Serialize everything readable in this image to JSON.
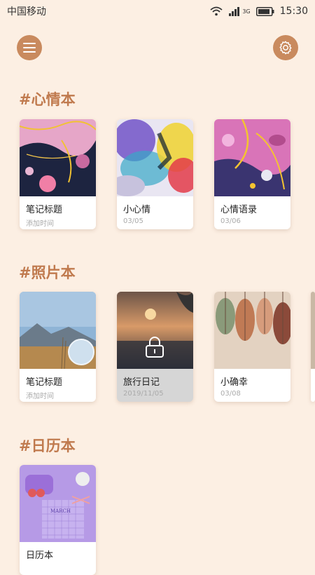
{
  "status": {
    "carrier": "中国移动",
    "network": "3G",
    "time": "15:30",
    "icons": [
      "wifi-icon",
      "signal-icon",
      "battery-icon"
    ]
  },
  "header": {
    "menu_icon": "menu-icon",
    "settings_icon": "gear-icon"
  },
  "sections": [
    {
      "title": "#心情本",
      "cards": [
        {
          "title": "笔记标题",
          "date": "添加时间",
          "locked": false
        },
        {
          "title": "小心情",
          "date": "03/05",
          "locked": false
        },
        {
          "title": "心情语录",
          "date": "03/06",
          "locked": false
        }
      ]
    },
    {
      "title": "#照片本",
      "cards": [
        {
          "title": "笔记标题",
          "date": "添加时间",
          "locked": false
        },
        {
          "title": "旅行日记",
          "date": "2019/11/05",
          "locked": true
        },
        {
          "title": "小确幸",
          "date": "03/08",
          "locked": false
        }
      ]
    },
    {
      "title": "#日历本",
      "cards": [
        {
          "title": "日历本",
          "date": "",
          "locked": false,
          "calendar_month": "MARCH"
        }
      ]
    }
  ],
  "colors": {
    "background": "#fcefe3",
    "accent": "#c98a5e",
    "section_title": "#c07a4e"
  }
}
